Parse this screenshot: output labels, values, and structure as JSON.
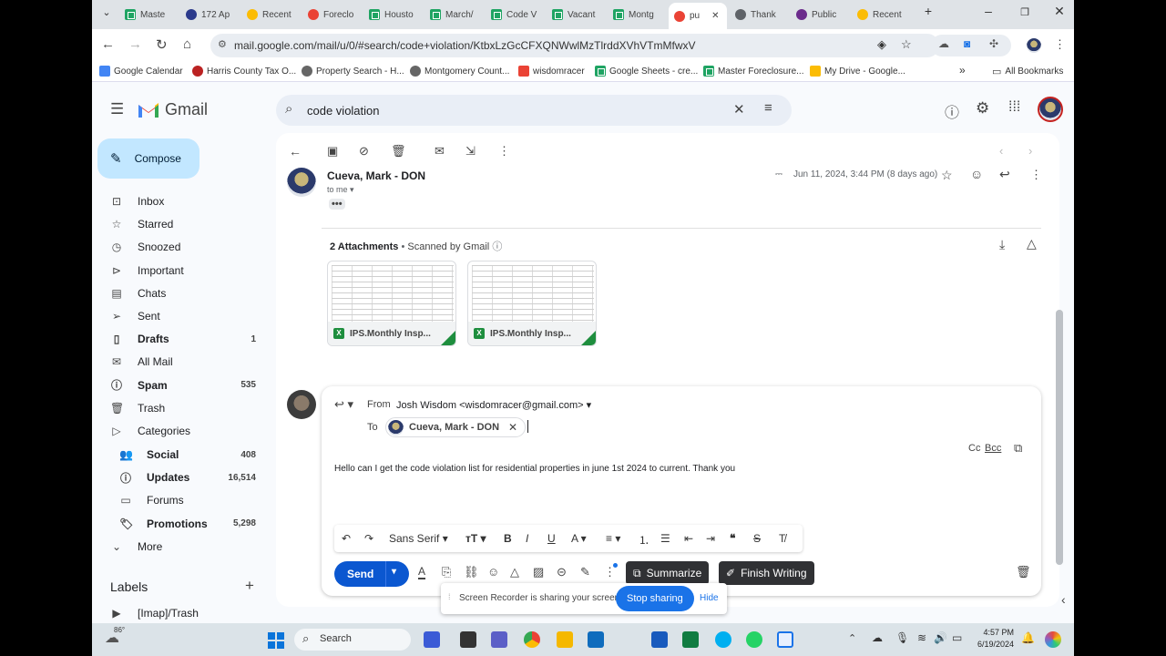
{
  "browser": {
    "tabs": [
      {
        "label": "Maste",
        "icon": "sheets"
      },
      {
        "label": "172 Ap",
        "icon": "hcad"
      },
      {
        "label": "Recent",
        "icon": "drive"
      },
      {
        "label": "Foreclo",
        "icon": "maps"
      },
      {
        "label": "Housto",
        "icon": "sheets"
      },
      {
        "label": "March/",
        "icon": "sheets"
      },
      {
        "label": "Code V",
        "icon": "sheets"
      },
      {
        "label": "Vacant",
        "icon": "sheets"
      },
      {
        "label": "Montg",
        "icon": "sheets"
      },
      {
        "label": "pu",
        "icon": "gmail"
      },
      {
        "label": "Thank",
        "icon": "globe"
      },
      {
        "label": "Public",
        "icon": "seal"
      },
      {
        "label": "Recent",
        "icon": "drive"
      }
    ],
    "url": "mail.google.com/mail/u/0/#search/code+violation/KtbxLzGcCFXQNWwlMzTlrddXVhVTmMfwxV",
    "bookmarks": [
      "Google Calendar",
      "Harris County Tax O...",
      "Property Search - H...",
      "Montgomery Count...",
      "wisdomracer",
      "Google Sheets - cre...",
      "Master Foreclosure...",
      "My Drive - Google...",
      "All Bookmarks"
    ]
  },
  "gmail": {
    "logo": "Gmail",
    "search_query": "code violation",
    "compose": "Compose",
    "nav": [
      {
        "label": "Inbox",
        "icon": "inbox-icon",
        "count": "",
        "bold": false
      },
      {
        "label": "Starred",
        "icon": "star-icon",
        "count": "",
        "bold": false
      },
      {
        "label": "Snoozed",
        "icon": "clock-icon",
        "count": "",
        "bold": false
      },
      {
        "label": "Important",
        "icon": "label-important-icon",
        "count": "",
        "bold": false
      },
      {
        "label": "Chats",
        "icon": "chat-icon",
        "count": "",
        "bold": false
      },
      {
        "label": "Sent",
        "icon": "send-icon",
        "count": "",
        "bold": false
      },
      {
        "label": "Drafts",
        "icon": "draft-icon",
        "count": "1",
        "bold": true
      },
      {
        "label": "All Mail",
        "icon": "all-mail-icon",
        "count": "",
        "bold": false
      },
      {
        "label": "Spam",
        "icon": "spam-icon",
        "count": "535",
        "bold": true
      },
      {
        "label": "Trash",
        "icon": "trash-icon",
        "count": "",
        "bold": false
      },
      {
        "label": "Categories",
        "icon": "label-icon",
        "count": "",
        "bold": false
      }
    ],
    "categories": [
      {
        "label": "Social",
        "count": "408"
      },
      {
        "label": "Updates",
        "count": "16,514"
      },
      {
        "label": "Forums",
        "count": ""
      },
      {
        "label": "Promotions",
        "count": "5,298"
      }
    ],
    "more": "More",
    "labels_heading": "Labels",
    "labels": [
      "[Imap]/Trash"
    ]
  },
  "message": {
    "sender": "Cueva, Mark - DON",
    "to": "to me",
    "date": "Jun 11, 2024, 3:44 PM (8 days ago)",
    "attachments_title": "2 Attachments",
    "scanned": "Scanned by Gmail",
    "attachments": [
      "IPS.Monthly Insp...",
      "IPS.Monthly Insp..."
    ]
  },
  "reply": {
    "from_label": "From",
    "from": "Josh Wisdom <wisdomracer@gmail.com>",
    "to_label": "To",
    "to_chip": "Cueva, Mark - DON",
    "cc": "Cc",
    "bcc": "Bcc",
    "body": "Hello can I get the code violation list for residential properties in june 1st 2024 to current. Thank you",
    "font": "Sans Serif",
    "send": "Send",
    "summarize": "Summarize",
    "finish_writing": "Finish Writing"
  },
  "share_bar": {
    "text": "Screen Recorder is sharing your screen.",
    "stop": "Stop sharing",
    "hide": "Hide"
  },
  "taskbar": {
    "temp": "86°",
    "search": "Search",
    "time": "4:57 PM",
    "date": "6/19/2024"
  }
}
